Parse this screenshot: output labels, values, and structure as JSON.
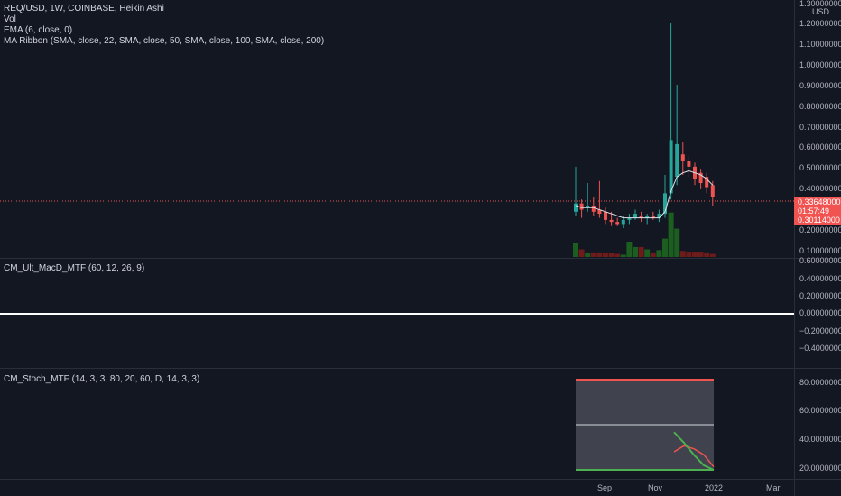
{
  "legend": {
    "symbol": "REQ/USD, 1W, COINBASE, Heikin Ashi",
    "vol": "Vol",
    "ema": "EMA (6, close, 0)",
    "ma_ribbon": "MA Ribbon (SMA, close, 22, SMA, close, 50, SMA, close, 100, SMA, close, 200)"
  },
  "macd_legend": "CM_Ult_MacD_MTF (60, 12, 26, 9)",
  "stoch_legend": "CM_Stoch_MTF (14, 3, 3, 80, 20, 60, D, 14, 3, 3)",
  "price_axis": {
    "currency": "USD",
    "ticks": [
      "1.30000000",
      "1.20000000",
      "1.10000000",
      "1.00000000",
      "0.90000000",
      "0.80000000",
      "0.70000000",
      "0.60000000",
      "0.50000000",
      "0.40000000",
      "0.20000000",
      "0.10000000"
    ],
    "current_price": "0.33648000",
    "countdown": "01:57:49",
    "low_price": "0.30114000"
  },
  "macd_axis": {
    "ticks": [
      "0.60000000",
      "0.40000000",
      "0.20000000",
      "0.00000000",
      "−0.20000000",
      "−0.40000000"
    ]
  },
  "stoch_axis": {
    "ticks": [
      "80.00000000",
      "60.00000000",
      "40.00000000",
      "20.00000000"
    ]
  },
  "time_axis": [
    "Sep",
    "Nov",
    "2022",
    "Mar"
  ],
  "colors": {
    "up": "#26a69a",
    "down": "#ef5350",
    "bg": "#131722",
    "vol_up": "#1b5e20",
    "vol_down": "#6d1b1b"
  },
  "chart_data": {
    "type": "candlestick",
    "candles": [
      {
        "o": 0.27,
        "h": 0.49,
        "l": 0.25,
        "c": 0.31
      },
      {
        "o": 0.31,
        "h": 0.33,
        "l": 0.24,
        "c": 0.28
      },
      {
        "o": 0.29,
        "h": 0.41,
        "l": 0.27,
        "c": 0.3
      },
      {
        "o": 0.3,
        "h": 0.34,
        "l": 0.25,
        "c": 0.27
      },
      {
        "o": 0.28,
        "h": 0.42,
        "l": 0.24,
        "c": 0.26
      },
      {
        "o": 0.27,
        "h": 0.29,
        "l": 0.21,
        "c": 0.23
      },
      {
        "o": 0.23,
        "h": 0.27,
        "l": 0.2,
        "c": 0.22
      },
      {
        "o": 0.22,
        "h": 0.24,
        "l": 0.2,
        "c": 0.21
      },
      {
        "o": 0.21,
        "h": 0.25,
        "l": 0.19,
        "c": 0.23
      },
      {
        "o": 0.23,
        "h": 0.26,
        "l": 0.21,
        "c": 0.24
      },
      {
        "o": 0.24,
        "h": 0.28,
        "l": 0.23,
        "c": 0.26
      },
      {
        "o": 0.25,
        "h": 0.27,
        "l": 0.22,
        "c": 0.24
      },
      {
        "o": 0.24,
        "h": 0.26,
        "l": 0.21,
        "c": 0.25
      },
      {
        "o": 0.25,
        "h": 0.27,
        "l": 0.23,
        "c": 0.24
      },
      {
        "o": 0.24,
        "h": 0.28,
        "l": 0.22,
        "c": 0.26
      },
      {
        "o": 0.26,
        "h": 0.45,
        "l": 0.24,
        "c": 0.36
      },
      {
        "o": 0.36,
        "h": 1.19,
        "l": 0.33,
        "c": 0.62
      },
      {
        "o": 0.44,
        "h": 0.89,
        "l": 0.4,
        "c": 0.6
      },
      {
        "o": 0.55,
        "h": 0.61,
        "l": 0.45,
        "c": 0.52
      },
      {
        "o": 0.52,
        "h": 0.54,
        "l": 0.44,
        "c": 0.49
      },
      {
        "o": 0.49,
        "h": 0.51,
        "l": 0.4,
        "c": 0.43
      },
      {
        "o": 0.46,
        "h": 0.48,
        "l": 0.38,
        "c": 0.41
      },
      {
        "o": 0.44,
        "h": 0.46,
        "l": 0.36,
        "c": 0.39
      },
      {
        "o": 0.4,
        "h": 0.42,
        "l": 0.3,
        "c": 0.34
      }
    ],
    "volume": [
      18,
      10,
      5,
      6,
      6,
      5,
      5,
      4,
      3,
      20,
      13,
      13,
      10,
      6,
      9,
      24,
      58,
      37,
      8,
      7,
      7,
      7,
      6,
      4
    ],
    "ema": [
      0.3,
      0.29,
      0.29,
      0.29,
      0.28,
      0.27,
      0.26,
      0.25,
      0.24,
      0.24,
      0.24,
      0.24,
      0.24,
      0.24,
      0.24,
      0.27,
      0.37,
      0.44,
      0.46,
      0.47,
      0.46,
      0.45,
      0.43,
      0.4
    ],
    "stoch_k": [
      45,
      38,
      30,
      23,
      20
    ],
    "stoch_d": [
      32,
      36,
      34,
      30,
      22
    ]
  }
}
